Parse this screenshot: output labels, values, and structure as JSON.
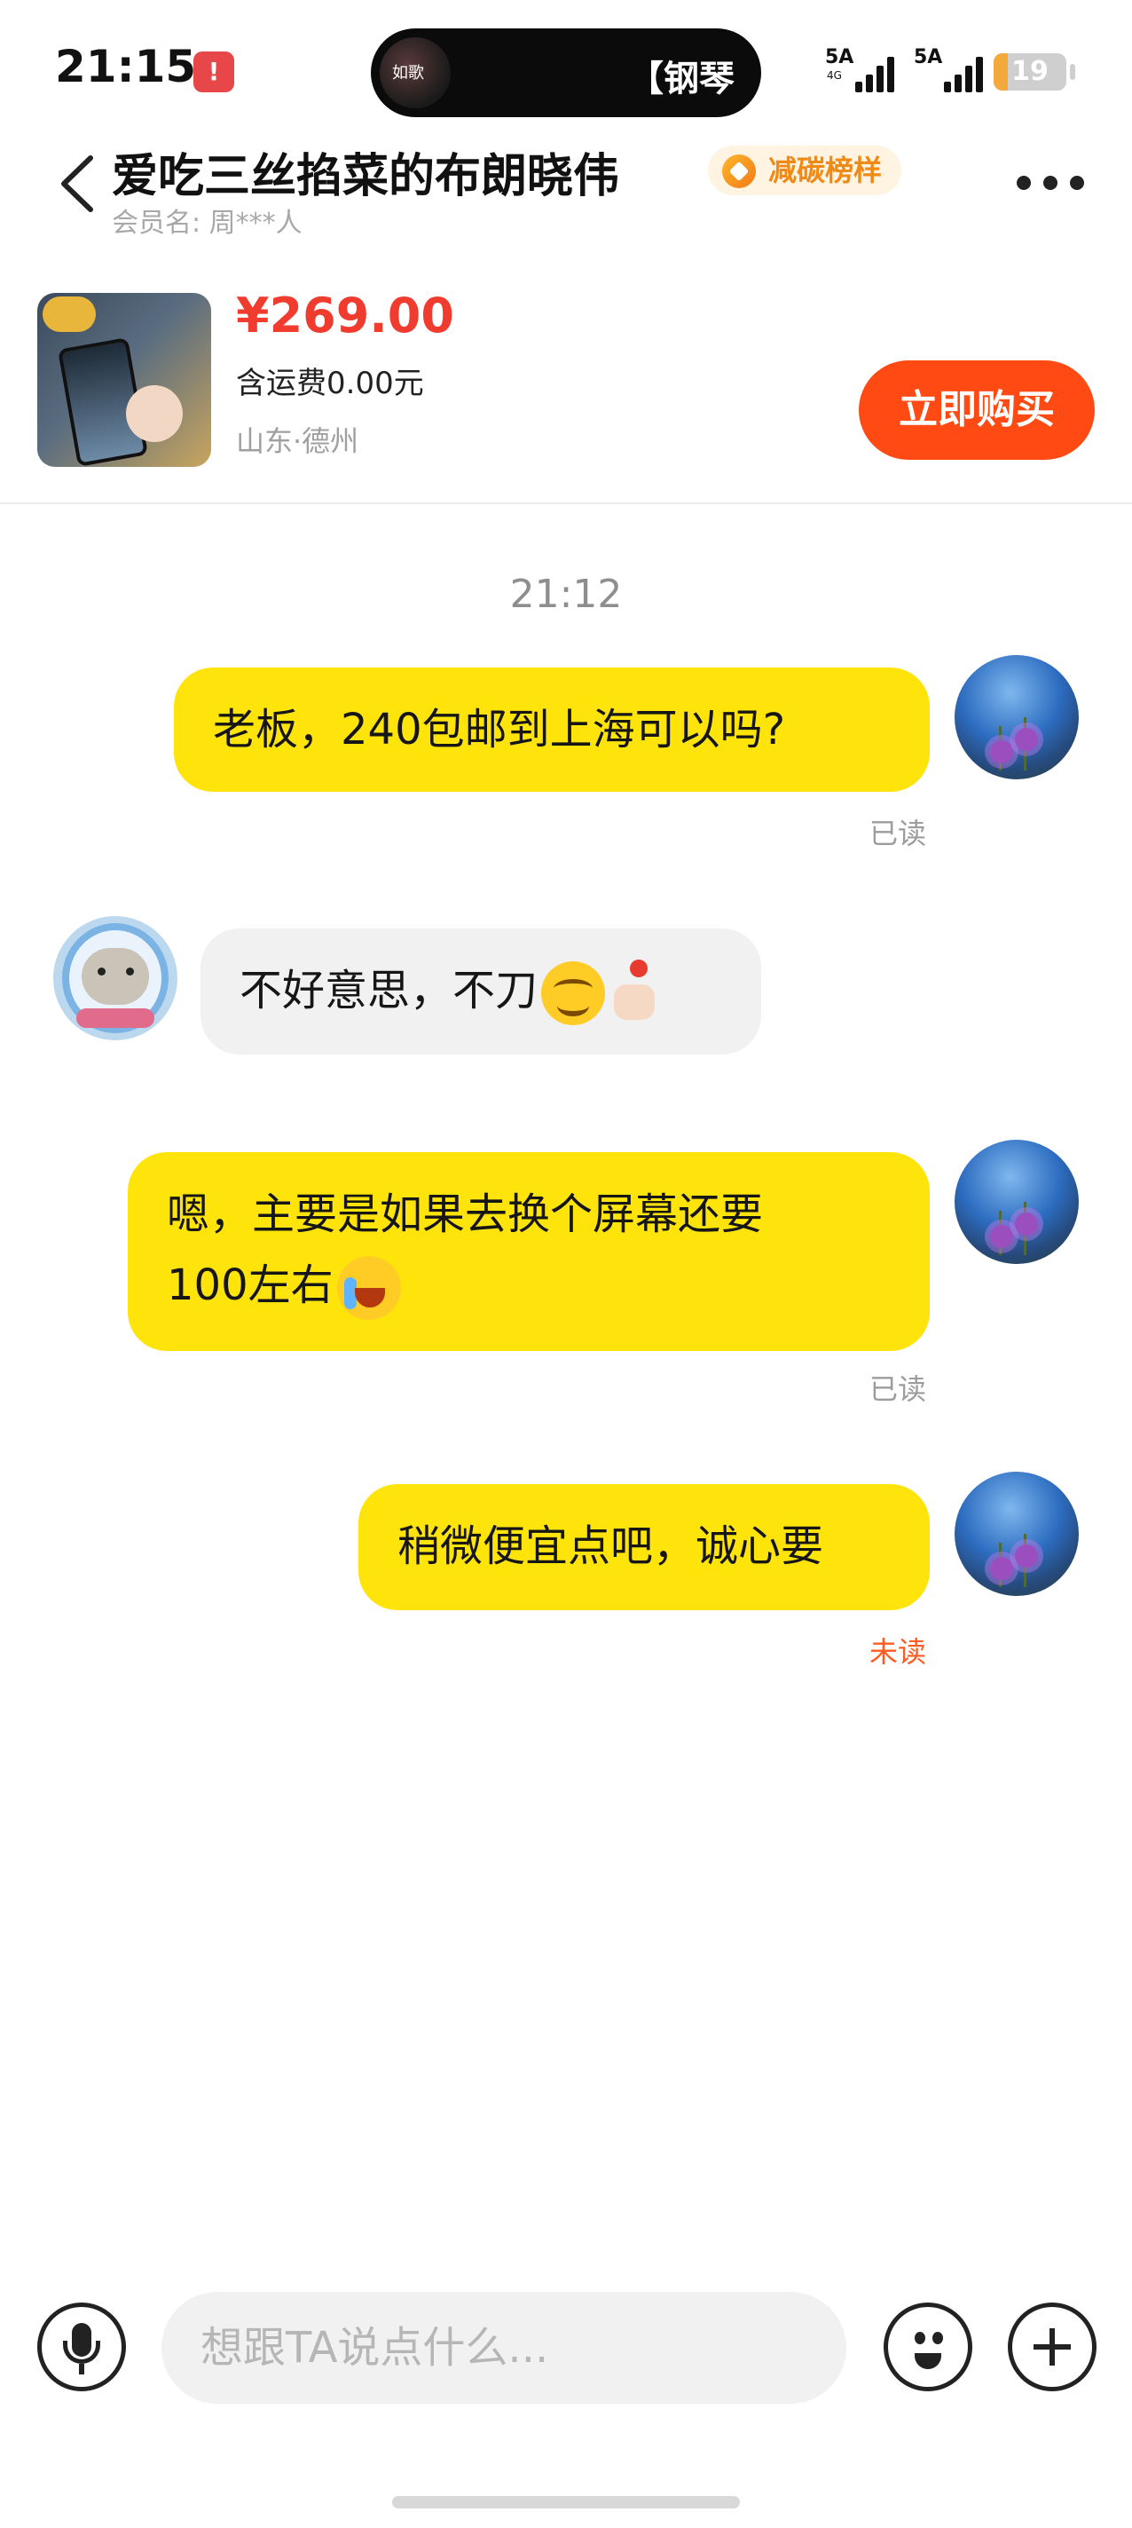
{
  "status_bar": {
    "time": "21:15",
    "notification_badge": "!",
    "island_thumb_text": "如歌",
    "island_text": "【钢琴",
    "signal1_label": "5A",
    "signal1_sub": "4G",
    "signal2_label": "5A",
    "battery": "19",
    "battery_level": 0.19,
    "battery_color": "#f3a93c"
  },
  "header": {
    "back_icon": "chevron-left-icon",
    "seller_name": "爱吃三丝掐菜的布朗晓伟",
    "badge_label": "减碳榜样",
    "member_label": "会员名: 周***人",
    "more_icon": "more-dots-icon"
  },
  "product": {
    "price": "¥269.00",
    "shipping": "含运费0.00元",
    "location": "山东·德州",
    "buy_label": "立即购买",
    "accent_color": "#ff4a13",
    "price_color": "#f03b2f"
  },
  "chat": {
    "time": "21:12",
    "messages": [
      {
        "side": "out",
        "lines": [
          "老板，240包邮到上海可以吗?"
        ],
        "status": "已读"
      },
      {
        "side": "in",
        "lines": [
          "不好意思，不刀"
        ],
        "emojis": [
          "smile-emoji",
          "flower-hand-emoji"
        ]
      },
      {
        "side": "out",
        "lines": [
          "嗯，主要是如果去换个屏幕还要",
          "100左右"
        ],
        "emojis": [
          "crying-laugh-emoji"
        ],
        "status": "已读"
      },
      {
        "side": "out",
        "lines": [
          "稍微便宜点吧，诚心要"
        ],
        "status": "未读"
      }
    ],
    "bubble_out_color": "#ffe40c",
    "bubble_in_color": "#f1f1f1",
    "unread_color": "#ff5a1f"
  },
  "input_bar": {
    "placeholder": "想跟TA说点什么...",
    "left_icon": "microphone-icon",
    "emoji_icon": "emoji-face-icon",
    "plus_icon": "plus-icon"
  }
}
